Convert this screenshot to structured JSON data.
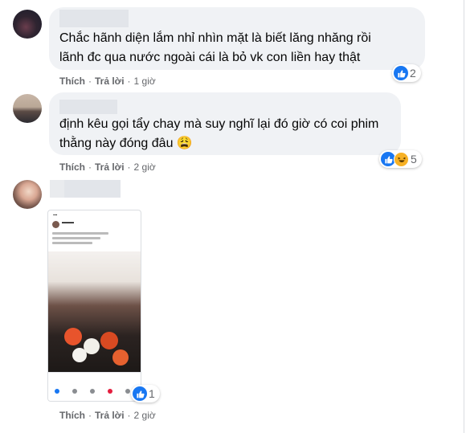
{
  "comments": [
    {
      "text_line1": "Chắc hãnh diện lắm nhỉ nhìn mặt là biết lăng nhăng rồi",
      "text_line2": "lãnh đc qua nước ngoài cái là bỏ vk con liền hay thật",
      "like_label": "Thích",
      "reply_label": "Trả lời",
      "time": "1 giờ",
      "reaction_count": "2",
      "reaction_icons": [
        "like-icon"
      ]
    },
    {
      "text_line1": "định kêu gọi tẩy chay mà suy nghĩ lại đó giờ có coi phim",
      "text_line2": "thằng này đóng đâu 😩",
      "like_label": "Thích",
      "reply_label": "Trả lời",
      "time": "2 giờ",
      "reaction_count": "5",
      "reaction_icons": [
        "like-icon",
        "haha-icon"
      ]
    },
    {
      "attachment": "screenshot-photo",
      "like_label": "Thích",
      "reply_label": "Trả lời",
      "time": "2 giờ",
      "reaction_count": "1",
      "reaction_icons": [
        "like-icon"
      ]
    }
  ],
  "colors": {
    "bubble": "#f0f2f5",
    "meta_text": "#65676b",
    "like_blue": "#1877f2",
    "haha_yellow": "#f7b125"
  }
}
